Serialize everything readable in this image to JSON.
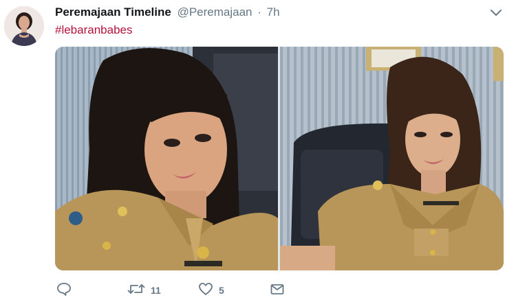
{
  "tweet": {
    "display_name": "Peremajaan Timeline",
    "handle": "@Peremajaan",
    "separator": "·",
    "time": "7h",
    "hashtag": "#lebaranbabes"
  },
  "actions": {
    "retweet_count": "11",
    "like_count": "5"
  },
  "colors": {
    "hashtag": "#b3123b",
    "muted": "#657786",
    "uniform": "#b8965a",
    "background": "#ffffff"
  },
  "icons": [
    "chevron-down-icon",
    "reply-icon",
    "retweet-icon",
    "heart-icon",
    "envelope-icon"
  ]
}
